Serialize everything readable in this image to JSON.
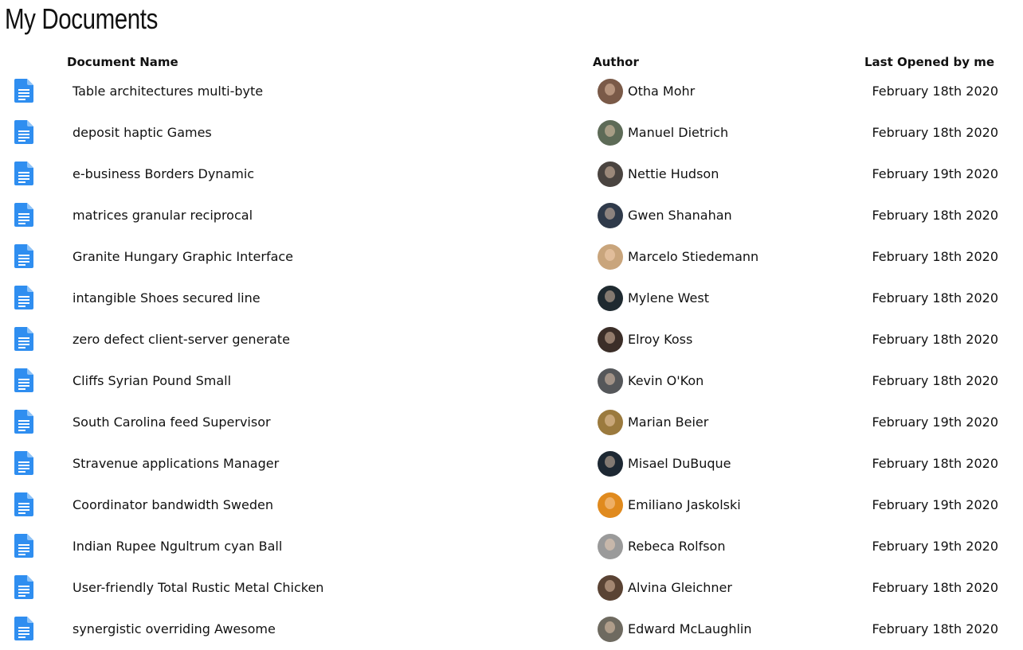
{
  "page": {
    "title": "My Documents"
  },
  "table": {
    "headers": {
      "name": "Document Name",
      "author": "Author",
      "opened": "Last Opened by me"
    },
    "doc_icon": "google-docs-icon",
    "rows": [
      {
        "name": "Table architectures multi-byte",
        "author": "Otha Mohr",
        "opened": "February 18th 2020",
        "avatar_color": "#7a5a48"
      },
      {
        "name": "deposit haptic Games",
        "author": "Manuel Dietrich",
        "opened": "February 18th 2020",
        "avatar_color": "#5d6b57"
      },
      {
        "name": "e-business Borders Dynamic",
        "author": "Nettie Hudson",
        "opened": "February 19th 2020",
        "avatar_color": "#4a4440"
      },
      {
        "name": "matrices granular reciprocal",
        "author": "Gwen Shanahan",
        "opened": "February 18th 2020",
        "avatar_color": "#2f3a4a"
      },
      {
        "name": "Granite Hungary Graphic Interface",
        "author": "Marcelo Stiedemann",
        "opened": "February 18th 2020",
        "avatar_color": "#c9a57c"
      },
      {
        "name": "intangible Shoes secured line",
        "author": "Mylene West",
        "opened": "February 18th 2020",
        "avatar_color": "#1f2a30"
      },
      {
        "name": "zero defect client-server generate",
        "author": "Elroy Koss",
        "opened": "February 18th 2020",
        "avatar_color": "#3b2e28"
      },
      {
        "name": "Cliffs Syrian Pound Small",
        "author": "Kevin O'Kon",
        "opened": "February 18th 2020",
        "avatar_color": "#55575a"
      },
      {
        "name": "South Carolina feed Supervisor",
        "author": "Marian Beier",
        "opened": "February 19th 2020",
        "avatar_color": "#9b7a3e"
      },
      {
        "name": "Stravenue applications Manager",
        "author": "Misael DuBuque",
        "opened": "February 18th 2020",
        "avatar_color": "#1d2833"
      },
      {
        "name": "Coordinator bandwidth Sweden",
        "author": "Emiliano Jaskolski",
        "opened": "February 19th 2020",
        "avatar_color": "#e08a1e"
      },
      {
        "name": "Indian Rupee Ngultrum cyan Ball",
        "author": "Rebeca Rolfson",
        "opened": "February 19th 2020",
        "avatar_color": "#9a9a9a"
      },
      {
        "name": "User-friendly Total Rustic Metal Chicken",
        "author": "Alvina Gleichner",
        "opened": "February 18th 2020",
        "avatar_color": "#5a4334"
      },
      {
        "name": "synergistic overriding Awesome",
        "author": "Edward McLaughlin",
        "opened": "February 18th 2020",
        "avatar_color": "#6e6a60"
      }
    ]
  }
}
